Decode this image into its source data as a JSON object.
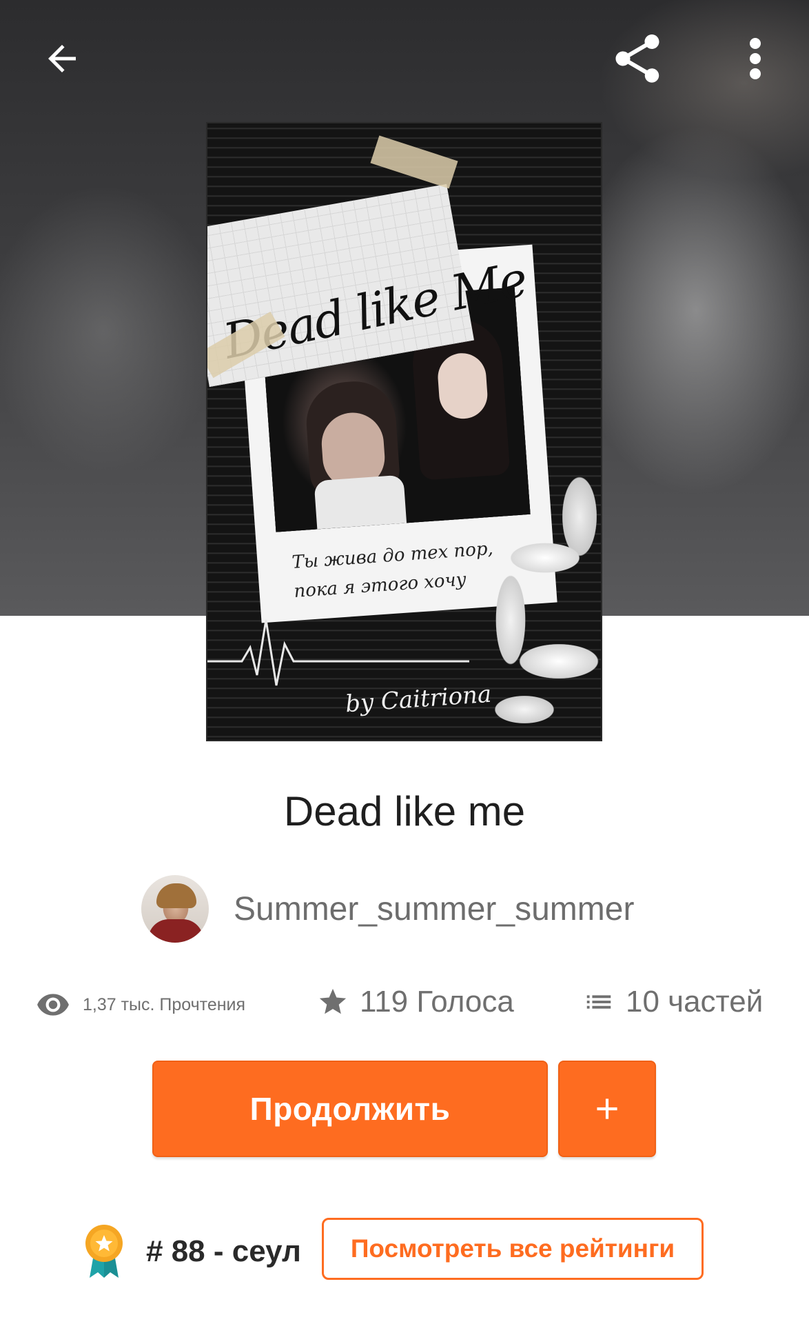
{
  "toolbar": {
    "back_icon": "arrow-left-icon",
    "share_icon": "share-icon",
    "more_icon": "more-vertical-icon"
  },
  "cover": {
    "title_art": "Dead like Me",
    "caption_line1": "Ты жива до тех пор,",
    "caption_line2": "пока я этого хочу",
    "byline": "by Caitriona"
  },
  "story": {
    "title": "Dead like me",
    "author": "Summer_summer_summer"
  },
  "stats": {
    "reads": "1,37 тыс. Прочтения",
    "votes": "119 Голоса",
    "parts": "10 частей"
  },
  "actions": {
    "continue_label": "Продолжить",
    "add_icon": "plus-icon"
  },
  "ranking": {
    "rank": "# 88 - сеул",
    "view_all_label": "Посмотреть все рейтинги"
  },
  "colors": {
    "accent": "#fe6c20",
    "badge_gold": "#f5a623",
    "badge_teal": "#1fa3a8"
  }
}
